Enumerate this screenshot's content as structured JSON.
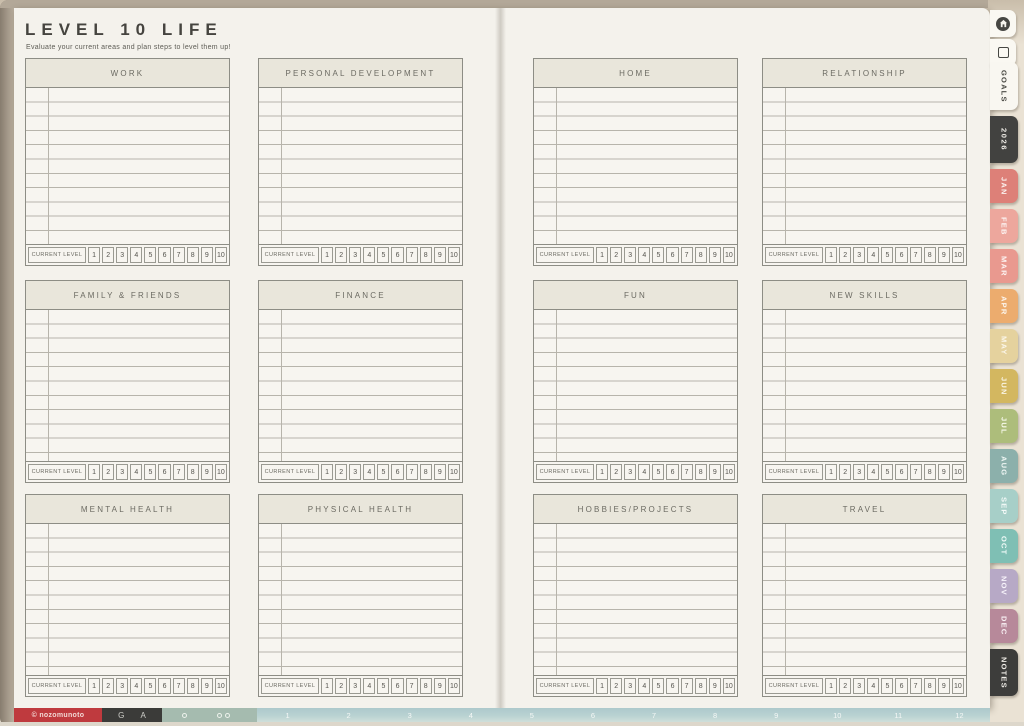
{
  "header": {
    "title": "LEVEL 10 LIFE",
    "subtitle": "Evaluate your current areas and plan steps to level them up!"
  },
  "categories": [
    "WORK",
    "PERSONAL DEVELOPMENT",
    "HOME",
    "RELATIONSHIP",
    "FAMILY & FRIENDS",
    "FINANCE",
    "FUN",
    "NEW SKILLS",
    "MENTAL HEALTH",
    "PHYSICAL HEALTH",
    "HOBBIES/PROJECTS",
    "TRAVEL"
  ],
  "level_row": {
    "label": "CURRENT LEVEL",
    "levels": [
      "1",
      "2",
      "3",
      "4",
      "5",
      "6",
      "7",
      "8",
      "9",
      "10"
    ]
  },
  "sidebar": {
    "icon_tabs": [
      "home-icon",
      "page-icon"
    ],
    "tabs": [
      {
        "label": "GOALS",
        "bg": "#f9f7f1",
        "fg": "#4b4b45"
      },
      {
        "label": "2026",
        "bg": "#424240",
        "fg": "#efede7"
      },
      {
        "label": "JAN",
        "bg": "#dd8078",
        "fg": "#fcf2ef"
      },
      {
        "label": "FEB",
        "bg": "#eda79d",
        "fg": "#fdf7f5"
      },
      {
        "label": "MAR",
        "bg": "#e9998f",
        "fg": "#fdf4f2"
      },
      {
        "label": "APR",
        "bg": "#ecac6e",
        "fg": "#fdf7ef"
      },
      {
        "label": "MAY",
        "bg": "#e5d29e",
        "fg": "#fbf7eb"
      },
      {
        "label": "JUN",
        "bg": "#d3b760",
        "fg": "#faf5e5"
      },
      {
        "label": "JUL",
        "bg": "#adbd7b",
        "fg": "#f8faec"
      },
      {
        "label": "AUG",
        "bg": "#8cb0ab",
        "fg": "#f0f7f5"
      },
      {
        "label": "SEP",
        "bg": "#a7cfc8",
        "fg": "#f4faf8"
      },
      {
        "label": "OCT",
        "bg": "#7fbfb4",
        "fg": "#effaf7"
      },
      {
        "label": "NOV",
        "bg": "#b7a9c6",
        "fg": "#f8f4fb"
      },
      {
        "label": "DEC",
        "bg": "#b7899a",
        "fg": "#faf3f6"
      },
      {
        "label": "NOTES",
        "bg": "#3d3d3b",
        "fg": "#efede7"
      }
    ]
  },
  "footer": {
    "copyright": "© nozomunoto",
    "links": [
      "G",
      "A"
    ],
    "month_numbers": [
      "1",
      "2",
      "3",
      "4",
      "5",
      "6",
      "7",
      "8",
      "9",
      "10",
      "11",
      "12"
    ]
  },
  "colors": {
    "accent_red": "#bf3a3e",
    "dark": "#3b3b39",
    "sage": "#a5bbaf",
    "month_bar": "#b9d2d2",
    "page": "#f4f2ec",
    "box_header": "#e9e6db",
    "frame": "#b3a898"
  }
}
